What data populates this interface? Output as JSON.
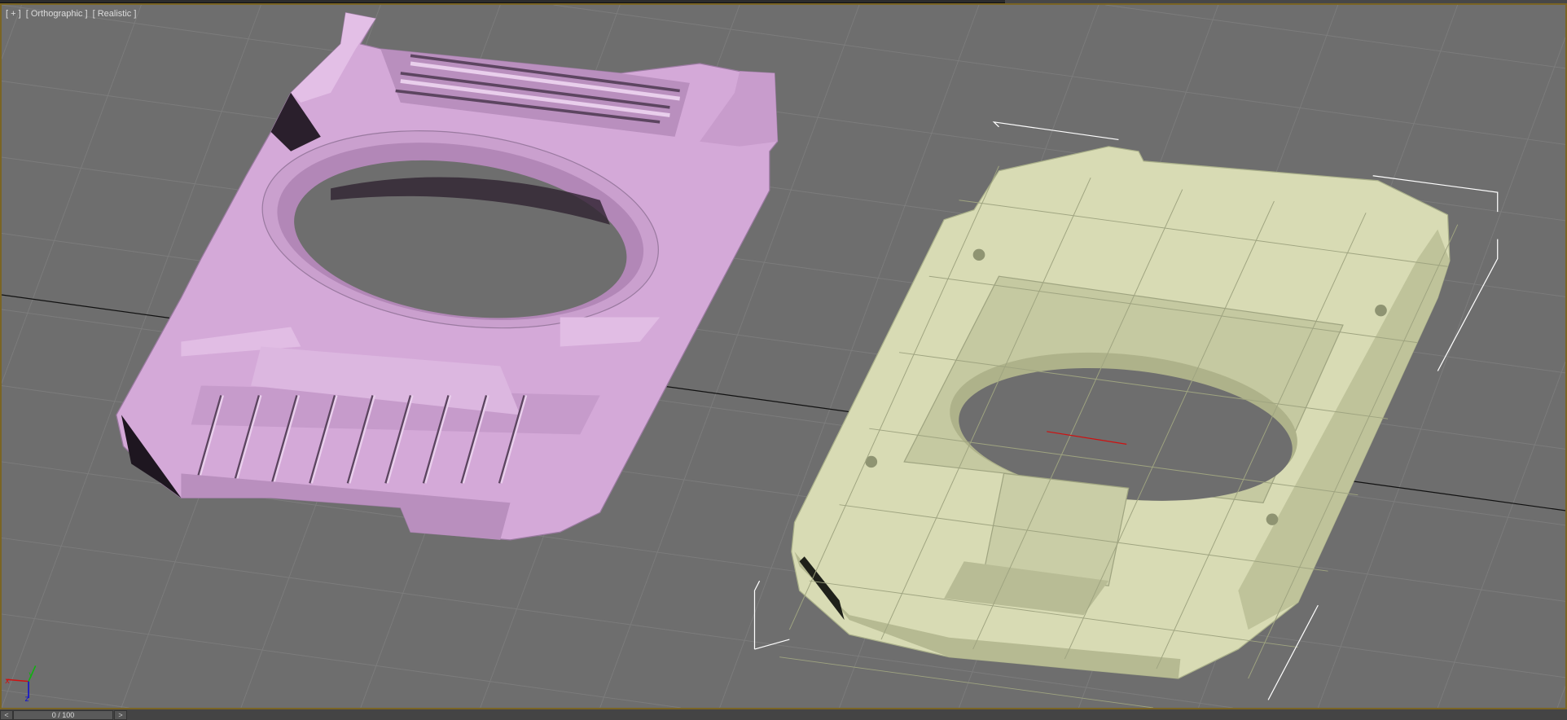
{
  "viewport": {
    "label_parts": [
      "[ + ]",
      "[ Orthographic ]",
      "[ Realistic ]"
    ]
  },
  "axis_gizmo": {
    "x": "x",
    "y": "y",
    "z": "z",
    "x_color": "#d01010",
    "y_color": "#10b010",
    "z_color": "#1010d0"
  },
  "timeline": {
    "frame": "0 / 100",
    "prev": "<",
    "next": ">"
  },
  "colors": {
    "viewport_bg": "#6e6e6e",
    "border": "#7a6424",
    "pink_object": "#d8aedb",
    "green_object": "#d9dcb6"
  }
}
